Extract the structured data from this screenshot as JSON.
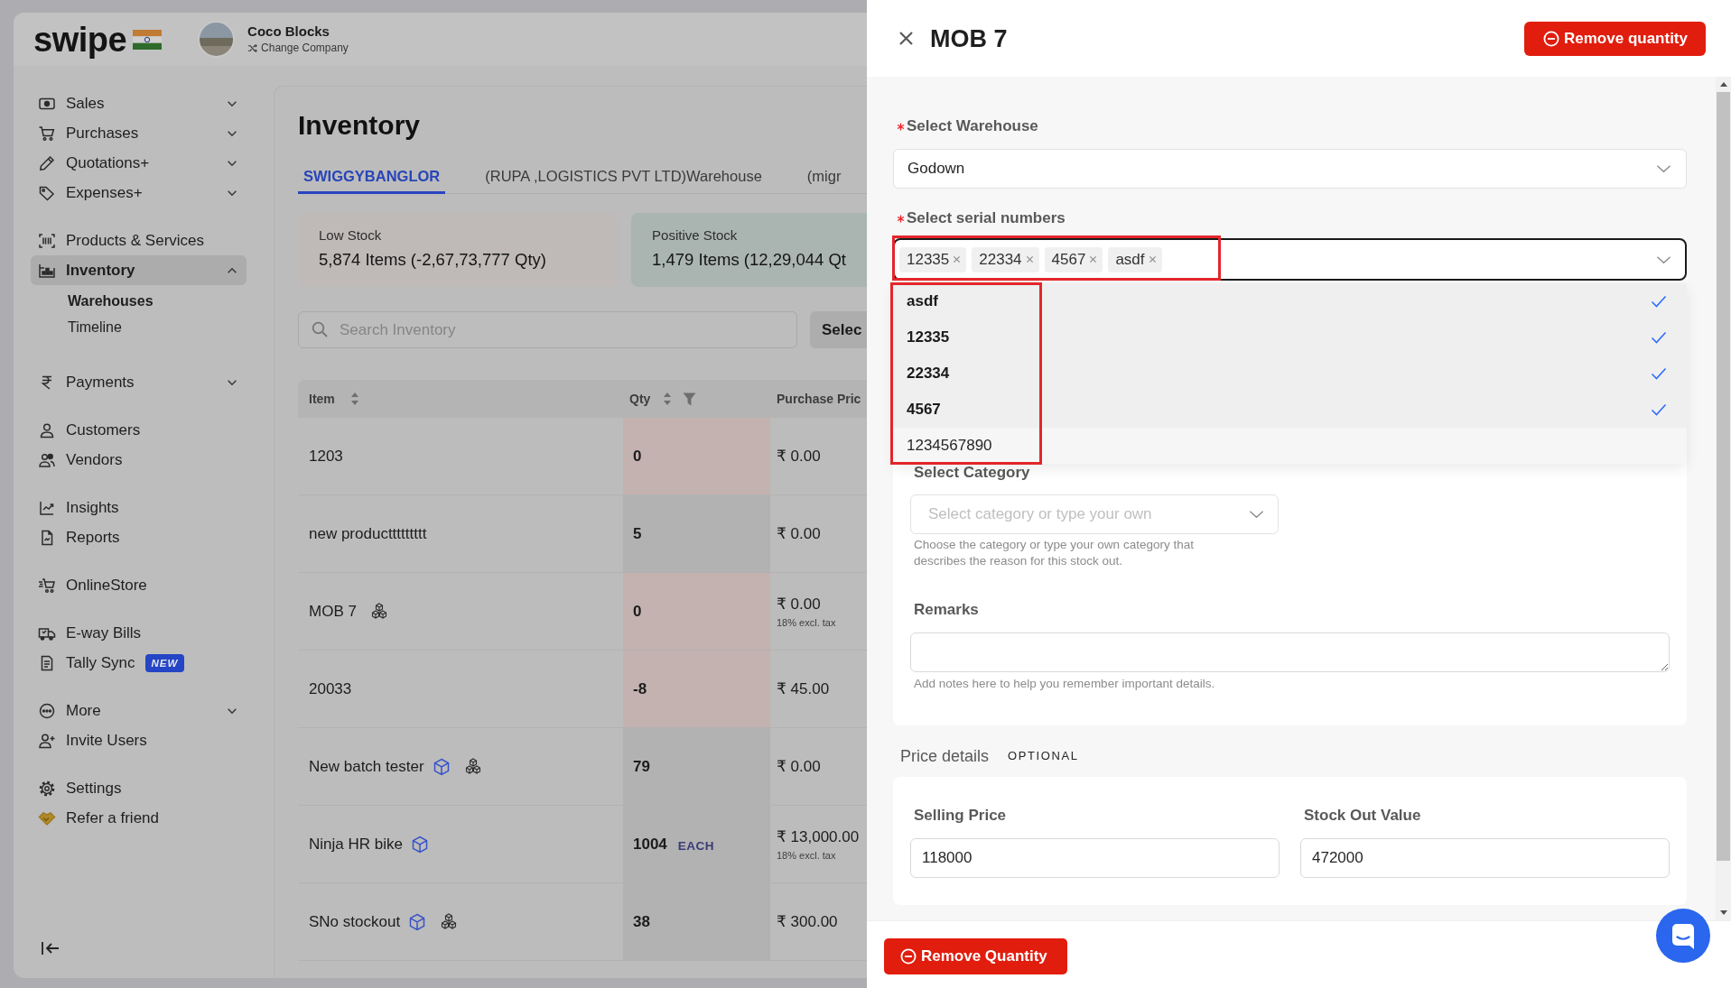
{
  "sidebar": {
    "logo": "swipe",
    "company": {
      "name": "Coco Blocks",
      "action": "Change Company"
    },
    "groups": [
      {
        "items": [
          {
            "label": "Sales",
            "kind": "menu",
            "expanded": false,
            "selected": false
          },
          {
            "label": "Purchases",
            "kind": "menu",
            "expanded": false,
            "selected": false
          },
          {
            "label": "Quotations+",
            "kind": "menu",
            "expanded": false,
            "selected": false
          },
          {
            "label": "Expenses+",
            "kind": "menu",
            "expanded": false,
            "selected": false
          }
        ]
      },
      {
        "items": [
          {
            "label": "Products & Services",
            "kind": "link",
            "selected": false
          },
          {
            "label": "Inventory",
            "kind": "menu",
            "expanded": true,
            "selected": true,
            "children": [
              {
                "label": "Warehouses",
                "selected": true
              },
              {
                "label": "Timeline",
                "selected": false
              }
            ]
          }
        ]
      },
      {
        "items": [
          {
            "label": "Payments",
            "kind": "menu",
            "expanded": false,
            "selected": false
          }
        ]
      },
      {
        "items": [
          {
            "label": "Customers",
            "kind": "link",
            "selected": false
          },
          {
            "label": "Vendors",
            "kind": "link",
            "selected": false
          }
        ]
      },
      {
        "items": [
          {
            "label": "Insights",
            "kind": "link",
            "selected": false
          },
          {
            "label": "Reports",
            "kind": "link",
            "selected": false
          }
        ]
      },
      {
        "items": [
          {
            "label": "OnlineStore",
            "kind": "link",
            "selected": false
          }
        ]
      },
      {
        "items": [
          {
            "label": "E-way Bills",
            "kind": "link",
            "selected": false
          },
          {
            "label": "Tally Sync",
            "kind": "link",
            "selected": false,
            "badge": "NEW"
          }
        ]
      },
      {
        "items": [
          {
            "label": "More",
            "kind": "menu",
            "expanded": false,
            "selected": false
          },
          {
            "label": "Invite Users",
            "kind": "link",
            "selected": false
          }
        ]
      },
      {
        "items": [
          {
            "label": "Settings",
            "kind": "link",
            "selected": false
          },
          {
            "label": "Refer a friend",
            "kind": "link",
            "selected": false
          }
        ]
      }
    ]
  },
  "main": {
    "title": "Inventory",
    "tabs": [
      {
        "label": "SWIGGYBANGLOR",
        "selected": true
      },
      {
        "label": "(RUPA ,LOGISTICS PVT LTD)Warehouse",
        "selected": false
      },
      {
        "label": "(migr",
        "selected": false
      }
    ],
    "stats": [
      {
        "kind": "low",
        "label": "Low Stock",
        "value": "5,874 Items (-2,67,73,777 Qty)"
      },
      {
        "kind": "positive",
        "label": "Positive Stock",
        "value": "1,479 Items (12,29,044 Qt"
      }
    ],
    "search": {
      "placeholder": "Search Inventory"
    },
    "select_button": "Selec",
    "table": {
      "columns": [
        {
          "label": "Item",
          "sortable": true,
          "filterable": false
        },
        {
          "label": "Qty",
          "sortable": true,
          "filterable": true
        },
        {
          "label": "Purchase Pric",
          "sortable": false,
          "filterable": false
        }
      ],
      "rows": [
        {
          "item": "1203",
          "qty": "0",
          "low_stock": true,
          "price": "₹ 0.00"
        },
        {
          "item": "new producttttttttt",
          "qty": "5",
          "low_stock": false,
          "price": "₹ 0.00"
        },
        {
          "item": "MOB 7",
          "icons": [
            {
              "kind": "cubes"
            }
          ],
          "qty": "0",
          "low_stock": true,
          "price": "₹ 0.00",
          "price_note": "18% excl. tax"
        },
        {
          "item": "20033",
          "qty": "-8",
          "low_stock": true,
          "price": "₹ 45.00"
        },
        {
          "item": "New batch tester",
          "icons": [
            {
              "kind": "cube"
            },
            {
              "kind": "cubes"
            }
          ],
          "qty": "79",
          "low_stock": false,
          "price": "₹ 0.00"
        },
        {
          "item": "Ninja HR bike",
          "icons": [
            {
              "kind": "cube"
            }
          ],
          "qty": "1004",
          "unit": "EACH",
          "low_stock": false,
          "price": "₹ 13,000.00",
          "price_note": "18% excl. tax"
        },
        {
          "item": "SNo stockout",
          "icons": [
            {
              "kind": "cube"
            },
            {
              "kind": "cubes"
            }
          ],
          "qty": "38",
          "low_stock": false,
          "price": "₹ 300.00"
        }
      ]
    }
  },
  "drawer": {
    "title": "MOB 7",
    "header_button": "Remove quantity",
    "warehouse": {
      "label": "Select Warehouse",
      "required": true,
      "value": "Godown"
    },
    "serials": {
      "label": "Select serial numbers",
      "required": true,
      "expanded": true,
      "tags": [
        "12335",
        "22334",
        "4567",
        "asdf"
      ],
      "options": [
        {
          "label": "asdf",
          "selected": true
        },
        {
          "label": "12335",
          "selected": true
        },
        {
          "label": "22334",
          "selected": true
        },
        {
          "label": "4567",
          "selected": true
        },
        {
          "label": "1234567890",
          "selected": false
        }
      ]
    },
    "category": {
      "label": "Select Category",
      "placeholder": "Select category or type your own",
      "help": "Choose the category or type your own category that describes the reason for this stock out."
    },
    "remarks": {
      "label": "Remarks",
      "help": "Add notes here to help you remember important details."
    },
    "price_details": {
      "title": "Price details",
      "tag": "OPTIONAL",
      "fields": [
        {
          "label": "Selling Price",
          "value": "118000"
        },
        {
          "label": "Stock Out Value",
          "value": "472000"
        }
      ]
    },
    "footer_button": "Remove Quantity"
  }
}
